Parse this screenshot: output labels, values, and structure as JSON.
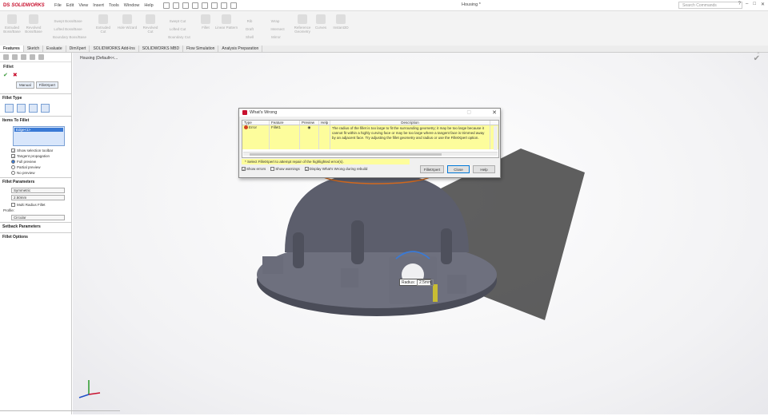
{
  "app": {
    "logo": "SOLIDWORKS",
    "logo_mark": "DS",
    "document_title": "Housing *",
    "search_placeholder": "Search Commands",
    "menu": [
      "File",
      "Edit",
      "View",
      "Insert",
      "Tools",
      "Window",
      "Help"
    ]
  },
  "ribbon": [
    "Extruded Boss/Base",
    "Revolved Boss/Base",
    "Swept Boss/Base",
    "Lofted Boss/Base",
    "Boundary Boss/Base",
    "Extruded Cut",
    "Hole Wizard",
    "Revolved Cut",
    "Swept Cut",
    "Lofted Cut",
    "Boundary Cut",
    "Fillet",
    "Linear Pattern",
    "Rib",
    "Draft",
    "Shell",
    "Wrap",
    "Intersect",
    "Mirror",
    "Reference Geometry",
    "Curves",
    "Instant3D"
  ],
  "tabs": [
    "Features",
    "Sketch",
    "Evaluate",
    "DimXpert",
    "SOLIDWORKS Add-Ins",
    "SOLIDWORKS MBD",
    "Flow Simulation",
    "Analysis Preparation"
  ],
  "tree": {
    "label": "Housing  (Default<<..."
  },
  "panel": {
    "title": "Fillet",
    "mode_manual": "Manual",
    "mode_xpert": "FilletXpert",
    "fillet_type": "Fillet Type",
    "items_to_fillet": "Items To Fillet",
    "selected_item": "Edge<1>",
    "show_toolbar": "Show selection toolbar",
    "tangent_propagation": "Tangent propagation",
    "full_preview": "Full preview",
    "partial_preview": "Partial preview",
    "no_preview": "No preview",
    "fillet_parameters": "Fillet Parameters",
    "symmetric": "Symmetric",
    "radius_value": "2.50mm",
    "multi_radius": "Multi Radius Fillet",
    "profile_label": "Profile:",
    "profile_value": "Circular",
    "setback": "Setback Parameters",
    "options": "Fillet Options"
  },
  "dialog": {
    "title": "What's Wrong",
    "columns": [
      "Type",
      "Feature",
      "Preview",
      "Help",
      "Description"
    ],
    "row": {
      "type": "Error",
      "feature": "Fillet1",
      "description": "The radius of the fillet is too large to fit the surrounding geometry; it may be too large because it cannot fit within a highly curving face or may be too large where a tangent face is trimmed away by an adjacent face. Try adjusting the fillet geometry and radius or use the FilletXpert option."
    },
    "hint": "* Select FilletXpert to attempt repair of the highlighted error(s).",
    "show_errors": "Show errors",
    "show_warnings": "Show warnings",
    "display_on_rebuild": "Display What's Wrong during rebuild",
    "btn_xpert": "FilletXpert",
    "btn_close": "Close",
    "btn_help": "Help"
  },
  "radius_tag": {
    "label": "Radius:",
    "value": "2.5mm"
  },
  "colors": {
    "accent": "#c8102e",
    "error_row": "#fdfd9c",
    "model": "#5a5c6a",
    "selection": "#3a7ad5"
  }
}
